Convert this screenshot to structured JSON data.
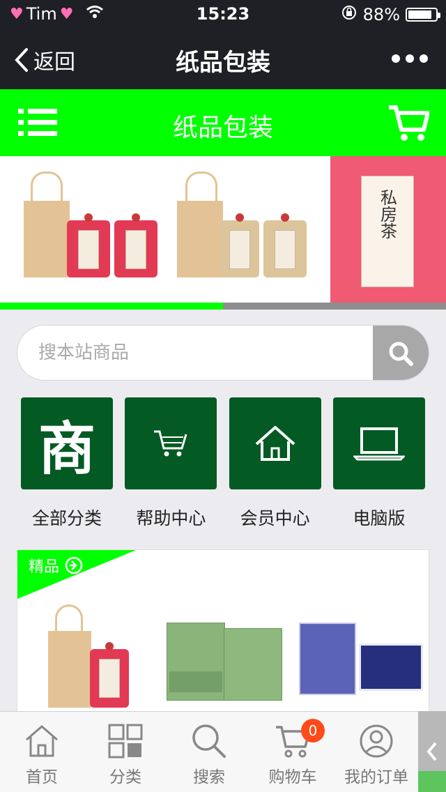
{
  "status_bar": {
    "carrier": "Tim",
    "time": "15:23",
    "battery": "88%",
    "battery_level": 0.88
  },
  "nav": {
    "back_label": "返回",
    "title": "纸品包装"
  },
  "header": {
    "title": "纸品包装",
    "accent_color": "#00ff00"
  },
  "banner": {
    "slide_progress": 0.5,
    "card_text": "私房茶"
  },
  "search": {
    "placeholder": "搜本站商品"
  },
  "shortcuts": [
    {
      "label": "全部分类",
      "icon": "shop-icon",
      "glyph": "商"
    },
    {
      "label": "帮助中心",
      "icon": "cart-icon"
    },
    {
      "label": "会员中心",
      "icon": "home-icon"
    },
    {
      "label": "电脑版",
      "icon": "laptop-icon"
    }
  ],
  "featured": {
    "tag": "精品",
    "tag_icon": "arrow-right-circle-icon"
  },
  "tabbar": {
    "items": [
      {
        "label": "首页",
        "icon": "home-icon"
      },
      {
        "label": "分类",
        "icon": "grid-icon"
      },
      {
        "label": "搜索",
        "icon": "search-icon"
      },
      {
        "label": "购物车",
        "icon": "cart-icon",
        "badge": "0"
      },
      {
        "label": "我的订单",
        "icon": "user-icon"
      }
    ]
  }
}
